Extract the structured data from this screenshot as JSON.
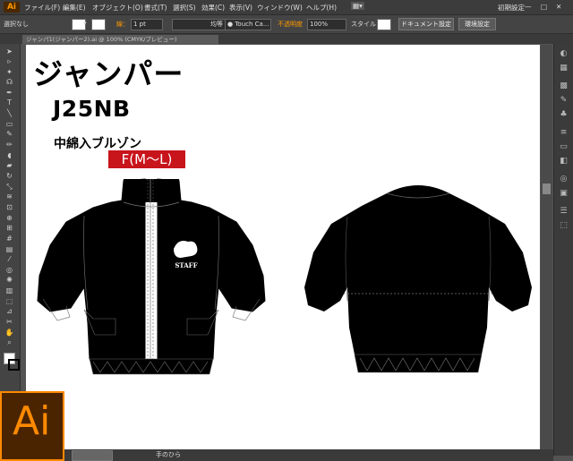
{
  "app": {
    "logo": "Ai",
    "workspace": "初期設定"
  },
  "menu": [
    "ファイル(F)",
    "編集(E)",
    "オブジェクト(O)",
    "書式(T)",
    "選択(S)",
    "効果(C)",
    "表示(V)",
    "ウィンドウ(W)",
    "ヘルプ(H)"
  ],
  "control": {
    "selection": "選択なし",
    "stroke_label": "線：",
    "stroke_weight": "1 pt",
    "stroke_profile": "均等",
    "brush": "Touch Ca...",
    "opacity_label": "不透明度",
    "opacity": "100%",
    "style_label": "スタイル：",
    "doc_settings": "ドキュメント設定",
    "env_settings": "環境設定"
  },
  "tab": {
    "document": "ジャンパ1(ジャンパー2).ai @ 100% (CMYK/プレビュー)"
  },
  "status": {
    "tool": "手のひら"
  },
  "artboard": {
    "title": "ジャンパー",
    "code": "J25NB",
    "description": "中綿入ブルゾン",
    "size": "F(M〜L)",
    "logo_text": "STAFF"
  },
  "badge": {
    "text": "Ai"
  },
  "colors": {
    "ui_bg": "#535353",
    "accent": "#ff8a00",
    "size_badge": "#c8141b"
  }
}
